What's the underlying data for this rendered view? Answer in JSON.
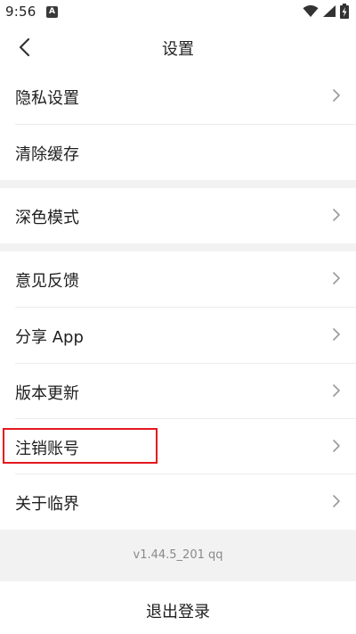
{
  "status_bar": {
    "time": "9:56",
    "notification_badge": "A",
    "icons": [
      "wifi-icon",
      "signal-icon",
      "battery-charging-icon"
    ]
  },
  "header": {
    "title": "设置",
    "back_icon": "chevron-left-icon"
  },
  "settings": {
    "items": [
      {
        "label": "隐私设置",
        "has_arrow": true
      },
      {
        "label": "清除缓存",
        "has_arrow": false
      },
      {
        "label": "深色模式",
        "has_arrow": true
      },
      {
        "label": "意见反馈",
        "has_arrow": true
      },
      {
        "label": "分享 App",
        "has_arrow": true
      },
      {
        "label": "版本更新",
        "has_arrow": true
      },
      {
        "label": "注销账号",
        "has_arrow": true
      },
      {
        "label": "关于临界",
        "has_arrow": true
      }
    ]
  },
  "footer": {
    "version": "v1.44.5_201 qq",
    "logout_label": "退出登录"
  },
  "colors": {
    "background": "#ffffff",
    "section_gap": "#f2f2f2",
    "highlight_border": "#e4171f",
    "text": "#1e1e1e",
    "muted_text": "#8a8a8a"
  }
}
